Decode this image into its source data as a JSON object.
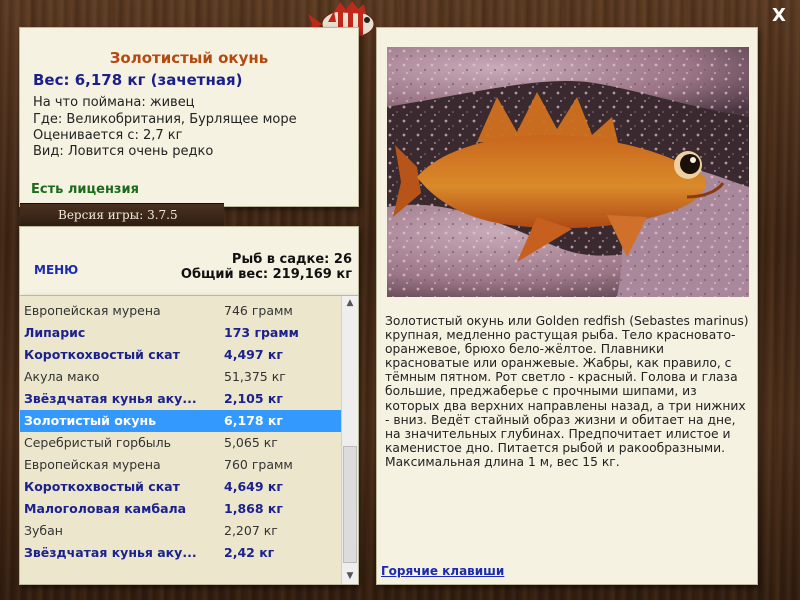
{
  "info": {
    "fish_name": "Золотистый окунь",
    "weight": "Вес: 6,178 кг (зачетная)",
    "caught_on": "На что поймана: живец",
    "location": "Где: Великобритания, Бурлящее море",
    "valued_from": "Оценивается с: 2,7 кг",
    "rarity": "Вид: Ловится очень редко",
    "license": "Есть лицензия"
  },
  "version": "Версия игры: 3.7.5",
  "menu_label": "МЕНЮ",
  "stats": {
    "fish_in_keepnet": "Рыб в садке: 26",
    "total_weight": "Общий вес: 219,169 кг"
  },
  "catch_list": [
    {
      "name": "Европейская мурена",
      "weight": "746 грамм",
      "style": "p"
    },
    {
      "name": "Липарис",
      "weight": "173 грамм",
      "style": "b"
    },
    {
      "name": "Короткохвостый скат",
      "weight": "4,497 кг",
      "style": "b"
    },
    {
      "name": "Акула мако",
      "weight": "51,375 кг",
      "style": "p"
    },
    {
      "name": "Звёздчатая кунья аку...",
      "weight": "2,105 кг",
      "style": "b"
    },
    {
      "name": "Золотистый окунь",
      "weight": "6,178 кг",
      "style": "sel"
    },
    {
      "name": "Серебристый горбыль",
      "weight": "5,065 кг",
      "style": "p"
    },
    {
      "name": "Европейская мурена",
      "weight": "760 грамм",
      "style": "p"
    },
    {
      "name": "Короткохвостый скат",
      "weight": "4,649 кг",
      "style": "b"
    },
    {
      "name": "Малоголовая камбала",
      "weight": "1,868 кг",
      "style": "b"
    },
    {
      "name": "Зубан",
      "weight": "2,207 кг",
      "style": "p"
    },
    {
      "name": "Звёздчатая кунья аку...",
      "weight": "2,42 кг",
      "style": "b"
    }
  ],
  "description": "Золотистый окунь или Golden redfish (Sebastes marinus) крупная, медленно растущая рыба. Тело красновато-оранжевое, брюхо бело-жёлтое. Плавники красноватые или оранжевые. Жабры, как правило, с тёмным пятном. Рот светло - красный. Голова и глаза большие, преджаберье с прочными шипами, из которых два верхних направлены назад, а три нижних - вниз. Ведёт стайный образ жизни и обитает на дне, на значительных глубинах. Предпочитает илистое и каменистое дно. Питается рыбой и ракообразными. Максимальная длина 1 м, вес 15 кг.",
  "hotkeys_label": "Горячие клавиши",
  "close_label": "X",
  "colors": {
    "accent_title": "#b44a10",
    "link": "#1b2bb0",
    "selection": "#3399ff",
    "license": "#1d6b1a"
  },
  "icons": {
    "logo": "fish-logo-icon",
    "close": "close-icon",
    "scroll_up": "arrow-up-icon",
    "scroll_down": "arrow-down-icon"
  }
}
